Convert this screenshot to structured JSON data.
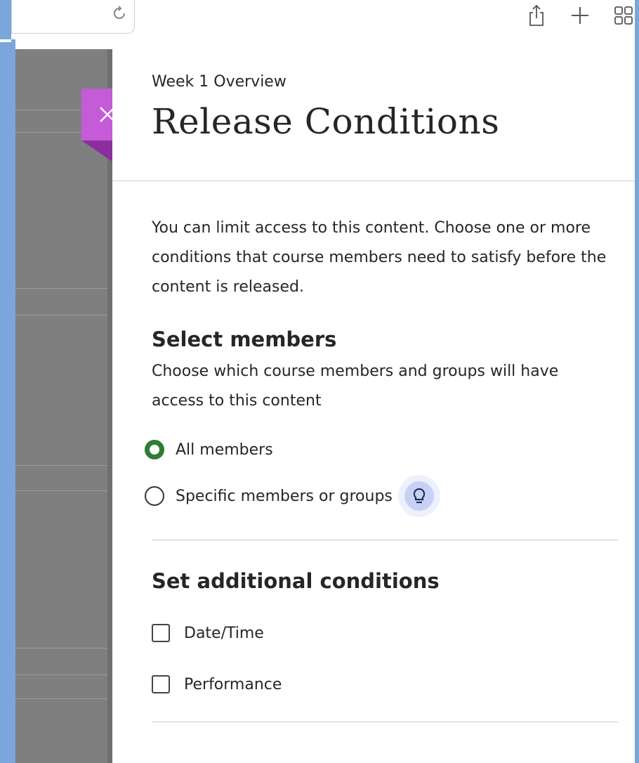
{
  "browser": {
    "icons": [
      "reload-icon",
      "share-icon",
      "new-tab-icon",
      "tab-overview-icon"
    ]
  },
  "panel": {
    "breadcrumb": "Week 1 Overview",
    "title": "Release Conditions",
    "description": "You can limit access to this content. Choose one or more conditions that course members need to satisfy before the content is released.",
    "select_members": {
      "heading": "Select members",
      "description": "Choose which course members and groups will have access to this content",
      "options": [
        {
          "label": "All members",
          "selected": true
        },
        {
          "label": "Specific members or groups",
          "selected": false
        }
      ]
    },
    "additional_conditions": {
      "heading": "Set additional conditions",
      "options": [
        {
          "label": "Date/Time",
          "checked": false
        },
        {
          "label": "Performance",
          "checked": false
        }
      ]
    }
  },
  "colors": {
    "close_tab": "#c55bd6",
    "radio_selected": "#2e7d32",
    "hint_button": "#c6d2f5",
    "frame": "#7aa6dc"
  }
}
